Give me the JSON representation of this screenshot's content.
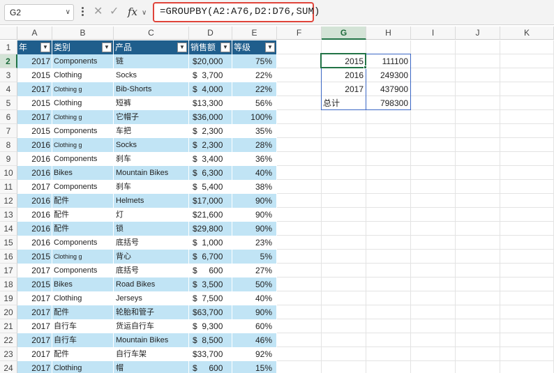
{
  "formula_bar": {
    "name_box": "G2",
    "formula": "=GROUPBY(A2:A76,D2:D76,SUM)"
  },
  "icons": {
    "cancel": "cancel-x-icon",
    "enter": "checkmark-icon",
    "insert_function": "fx-icon"
  },
  "columns": [
    "A",
    "B",
    "C",
    "D",
    "E",
    "F",
    "G",
    "H",
    "I",
    "J",
    "K"
  ],
  "rows": [
    "1",
    "2",
    "3",
    "4",
    "5",
    "6",
    "7",
    "8",
    "9",
    "10",
    "11",
    "12",
    "13",
    "14",
    "15",
    "16",
    "17",
    "18",
    "19",
    "20",
    "21",
    "22",
    "23",
    "24"
  ],
  "table": {
    "headers": [
      "年",
      "类别",
      "产品",
      "销售额",
      "等级"
    ],
    "rows": [
      {
        "year": "2017",
        "category": "Components",
        "product": "链",
        "sales": "$20,000",
        "grade": "75%"
      },
      {
        "year": "2015",
        "category": "Clothing",
        "product": "Socks",
        "sales": "$  3,700",
        "grade": "22%"
      },
      {
        "year": "2017",
        "category": "Clothing    g",
        "product": "Bib-Shorts",
        "sales": "$  4,000",
        "grade": "22%"
      },
      {
        "year": "2015",
        "category": "Clothing",
        "product": "短裤",
        "sales": "$13,300",
        "grade": "56%"
      },
      {
        "year": "2017",
        "category": "Clothing    g",
        "product": "它帽子",
        "sales": "$36,000",
        "grade": "100%"
      },
      {
        "year": "2015",
        "category": "Components",
        "product": "车把",
        "sales": "$  2,300",
        "grade": "35%"
      },
      {
        "year": "2016",
        "category": "Clothing    g",
        "product": "Socks",
        "sales": "$  2,300",
        "grade": "28%"
      },
      {
        "year": "2016",
        "category": "Components",
        "product": "刹车",
        "sales": "$  3,400",
        "grade": "36%"
      },
      {
        "year": "2016",
        "category": "Bikes",
        "product": "Mountain Bikes",
        "sales": "$  6,300",
        "grade": "40%"
      },
      {
        "year": "2017",
        "category": "Components",
        "product": "刹车",
        "sales": "$  5,400",
        "grade": "38%"
      },
      {
        "year": "2016",
        "category": "配件",
        "product": "Helmets",
        "sales": "$17,000",
        "grade": "90%"
      },
      {
        "year": "2016",
        "category": "配件",
        "product": "灯",
        "sales": "$21,600",
        "grade": "90%"
      },
      {
        "year": "2016",
        "category": "配件",
        "product": "锁",
        "sales": "$29,800",
        "grade": "90%"
      },
      {
        "year": "2016",
        "category": "Components",
        "product": "底括号",
        "sales": "$  1,000",
        "grade": "23%"
      },
      {
        "year": "2015",
        "category": "Clothing    g",
        "product": "背心",
        "sales": "$  6,700",
        "grade": "5%"
      },
      {
        "year": "2017",
        "category": "Components",
        "product": "底括号",
        "sales": "$     600",
        "grade": "27%"
      },
      {
        "year": "2015",
        "category": "Bikes",
        "product": "Road Bikes",
        "sales": "$  3,500",
        "grade": "50%"
      },
      {
        "year": "2017",
        "category": "Clothing",
        "product": "Jerseys",
        "sales": "$  7,500",
        "grade": "40%"
      },
      {
        "year": "2017",
        "category": "配件",
        "product": "轮胎和管子",
        "sales": "$63,700",
        "grade": "90%"
      },
      {
        "year": "2017",
        "category": "自行车",
        "product": "货运自行车",
        "sales": "$  9,300",
        "grade": "60%"
      },
      {
        "year": "2017",
        "category": "自行车",
        "product": "Mountain Bikes",
        "sales": "$  8,500",
        "grade": "46%"
      },
      {
        "year": "2017",
        "category": "配件",
        "product": "自行车架",
        "sales": "$33,700",
        "grade": "92%"
      },
      {
        "year": "2017",
        "category": "Clothing",
        "product": "帽",
        "sales": "$     600",
        "grade": "15%"
      }
    ]
  },
  "groupby": {
    "rows": [
      {
        "key": "2015",
        "value": "111100"
      },
      {
        "key": "2016",
        "value": "249300"
      },
      {
        "key": "2017",
        "value": "437900"
      },
      {
        "key": "总计",
        "value": "798300"
      }
    ]
  }
}
